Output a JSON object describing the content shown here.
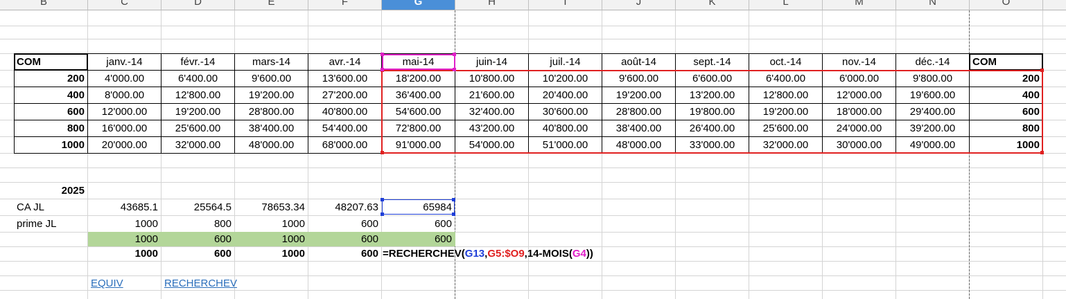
{
  "columns": [
    "B",
    "C",
    "D",
    "E",
    "F",
    "G",
    "H",
    "I",
    "J",
    "K",
    "L",
    "M",
    "N",
    "O"
  ],
  "selected_column": "G",
  "table": {
    "corner_left": "COM",
    "corner_right": "COM",
    "months": [
      "janv.-14",
      "févr.-14",
      "mars-14",
      "avr.-14",
      "mai-14",
      "juin-14",
      "juil.-14",
      "août-14",
      "sept.-14",
      "oct.-14",
      "nov.-14",
      "déc.-14"
    ],
    "rows": [
      {
        "com": "200",
        "values": [
          "4'000.00",
          "6'400.00",
          "9'600.00",
          "13'600.00",
          "18'200.00",
          "10'800.00",
          "10'200.00",
          "9'600.00",
          "6'600.00",
          "6'400.00",
          "6'000.00",
          "9'800.00"
        ]
      },
      {
        "com": "400",
        "values": [
          "8'000.00",
          "12'800.00",
          "19'200.00",
          "27'200.00",
          "36'400.00",
          "21'600.00",
          "20'400.00",
          "19'200.00",
          "13'200.00",
          "12'800.00",
          "12'000.00",
          "19'600.00"
        ]
      },
      {
        "com": "600",
        "values": [
          "12'000.00",
          "19'200.00",
          "28'800.00",
          "40'800.00",
          "54'600.00",
          "32'400.00",
          "30'600.00",
          "28'800.00",
          "19'800.00",
          "19'200.00",
          "18'000.00",
          "29'400.00"
        ]
      },
      {
        "com": "800",
        "values": [
          "16'000.00",
          "25'600.00",
          "38'400.00",
          "54'400.00",
          "72'800.00",
          "43'200.00",
          "40'800.00",
          "38'400.00",
          "26'400.00",
          "25'600.00",
          "24'000.00",
          "39'200.00"
        ]
      },
      {
        "com": "1000",
        "values": [
          "20'000.00",
          "32'000.00",
          "48'000.00",
          "68'000.00",
          "91'000.00",
          "54'000.00",
          "51'000.00",
          "48'000.00",
          "33'000.00",
          "32'000.00",
          "30'000.00",
          "49'000.00"
        ]
      }
    ]
  },
  "summary": {
    "year": "2025",
    "ca_label": "CA JL",
    "ca_values": [
      "43685.1",
      "25564.5",
      "78653.34",
      "48207.63",
      "65984"
    ],
    "prime_label": "prime JL",
    "prime_values": [
      "1000",
      "800",
      "1000",
      "600",
      "600"
    ],
    "green_values": [
      "1000",
      "600",
      "1000",
      "600",
      "600"
    ],
    "bold_values": [
      "1000",
      "600",
      "1000",
      "600"
    ],
    "formula": {
      "p1": "=RECHERCHEV(",
      "ref1": "G13",
      "sep1": ",",
      "ref2": "G5:$O9",
      "p2": ",14-MOIS(",
      "ref3": "G4",
      "p3": "))"
    }
  },
  "links": {
    "equiv": "EQUIV",
    "recherchev": "RECHERCHEV"
  },
  "colors": {
    "ref1": "#1f3fd8",
    "ref2": "#e02020",
    "ref3": "#e020c8",
    "green": "#b3d699",
    "link": "#2a6ebb",
    "selected_header": "#4a8fd8"
  }
}
